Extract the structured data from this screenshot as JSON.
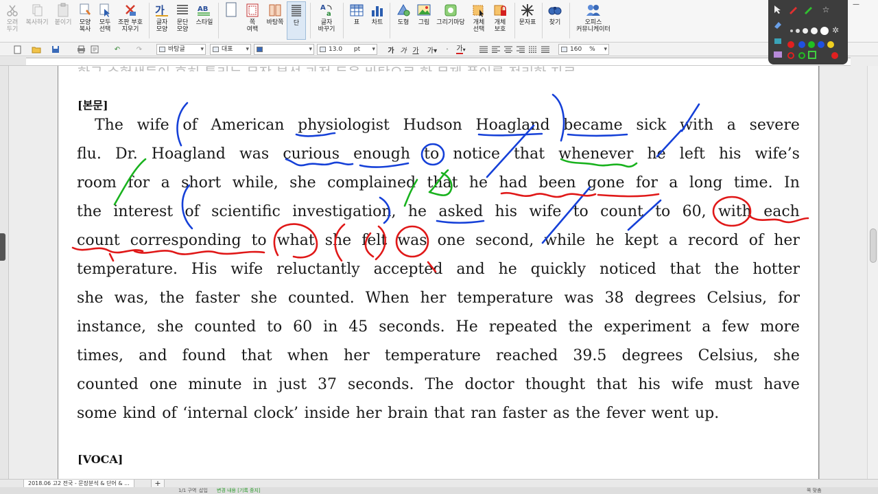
{
  "ribbon": {
    "buttons": [
      {
        "label": "오려\n두기",
        "icon": "scissors-icon",
        "disabled": true
      },
      {
        "label": "복사하기",
        "icon": "copy-icon",
        "disabled": true
      },
      {
        "label": "붙이기",
        "icon": "paste-icon",
        "disabled": true
      },
      {
        "label": "모양\n복사",
        "icon": "format-painter-icon"
      },
      {
        "label": "모두\n선택",
        "icon": "select-all-icon"
      },
      {
        "label": "조판 부호\n지우기",
        "icon": "erase-codes-icon"
      },
      {
        "label": "글자\n모양",
        "icon": "char-shape-icon"
      },
      {
        "label": "문단\n모양",
        "icon": "para-shape-icon"
      },
      {
        "label": "스타일",
        "icon": "style-icon"
      },
      {
        "label": "쪽\n여백",
        "icon": "page-margin-icon"
      },
      {
        "label": "바탕쪽",
        "icon": "master-page-icon"
      },
      {
        "label": "단",
        "icon": "columns-icon"
      },
      {
        "label": "글자\n바꾸기",
        "icon": "replace-char-icon"
      },
      {
        "label": "표",
        "icon": "table-icon"
      },
      {
        "label": "차트",
        "icon": "chart-icon"
      },
      {
        "label": "도형",
        "icon": "shape-icon"
      },
      {
        "label": "그림",
        "icon": "picture-icon"
      },
      {
        "label": "그리기마당",
        "icon": "clipart-icon"
      },
      {
        "label": "개체\n선택",
        "icon": "object-select-icon"
      },
      {
        "label": "개체\n보호",
        "icon": "object-protect-icon"
      },
      {
        "label": "문자표",
        "icon": "symbol-icon"
      },
      {
        "label": "찾기",
        "icon": "find-icon"
      },
      {
        "label": "오피스\n커뮤니케이터",
        "icon": "communicator-icon"
      }
    ]
  },
  "format_bar": {
    "style_value": "바탕글",
    "lang_value": "대표",
    "font_value": "",
    "size_value": "13.0",
    "size_unit": "pt",
    "zoom_value": "160",
    "zoom_unit": "%",
    "text_color": "#d42020"
  },
  "document": {
    "prev_line": "한국 수험생들이 흔히 틀리는 문장 분석 과정 등을 바탕으로 한 문제 풀이를 정리한 자료",
    "heading_main": "[본문]",
    "lines": [
      "The wife of American physiologist Hudson Hoagland became sick with a severe",
      "flu. Dr. Hoagland was curious enough to notice that whenever he left his wife’s",
      "room for a short while, she complained that he had been gone for a long time. In",
      "the interest of scientific investigation, he asked his wife to count to 60, with each",
      "count corresponding to what she felt was one second, while he kept a record of her",
      "temperature. His wife reluctantly accepted and he quickly noticed that the hotter",
      "she was, the faster she counted. When her temperature was 38 degrees Celsius, for",
      "instance, she counted to 60 in 45 seconds. He repeated the experiment a few more",
      "times, and found that when her temperature reached 39.5 degrees Celsius, she",
      "counted one minute in just 37 seconds. The doctor thought that his wife must have",
      "some kind of ‘internal clock’ inside her brain that ran faster as the fever went up."
    ],
    "heading_voca": "[VOCA]"
  },
  "ink_colors": {
    "blue": "#1540d8",
    "red": "#e01818",
    "green": "#19b21e"
  },
  "tabs": {
    "doc_tab": "2018.06 고2 전국 - 문장분석 & 단어 & ...",
    "add_tab": "+"
  },
  "status": {
    "page": "1/1 구역",
    "mode": "삽입",
    "track": "변경 내용 [기록 중지]",
    "zoom": "쪽 맞춤"
  }
}
